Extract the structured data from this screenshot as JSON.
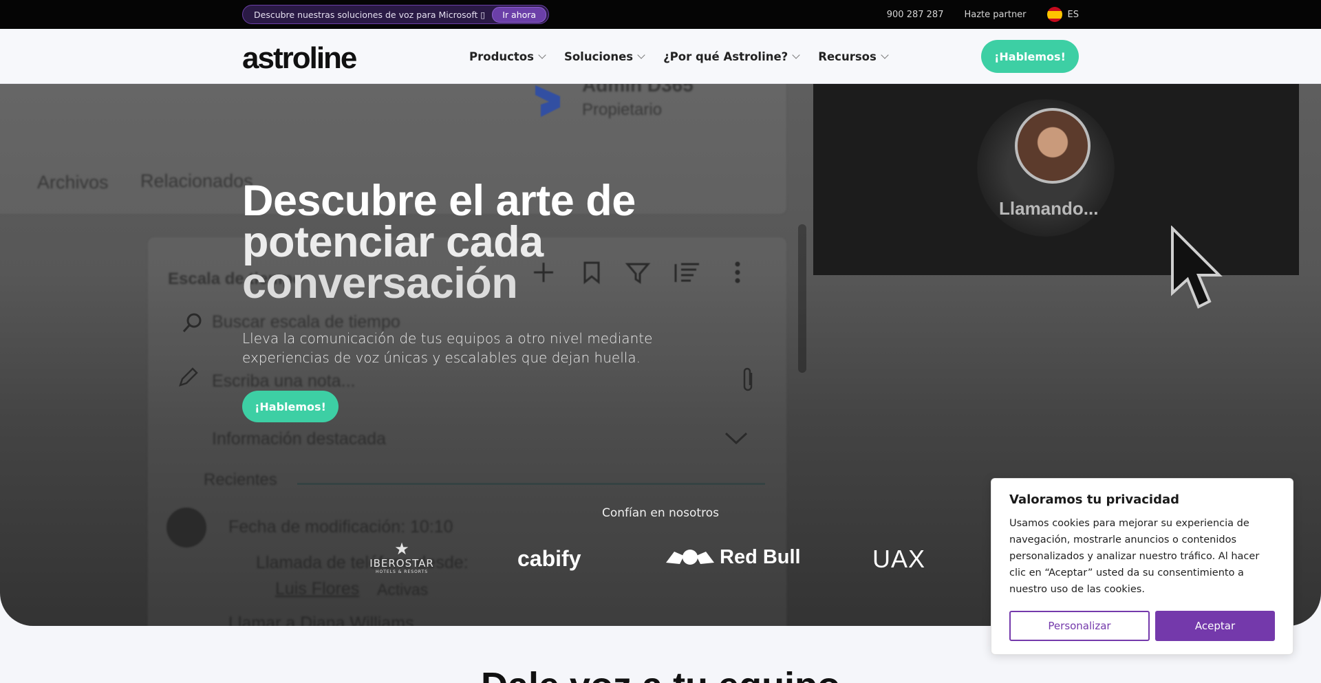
{
  "topbar": {
    "promo_text": "Descubre nuestras soluciones de voz para Microsoft ▯",
    "promo_cta": "Ir ahora",
    "phone": "900 287 287",
    "partner_link": "Hazte partner",
    "language": "ES"
  },
  "header": {
    "logo": "astroline",
    "nav": [
      {
        "label": "Productos"
      },
      {
        "label": "Soluciones"
      },
      {
        "label": "¿Por qué Astroline?"
      },
      {
        "label": "Recursos"
      }
    ],
    "cta": "¡Hablemos!"
  },
  "hero": {
    "title_line1": "Descubre el arte de",
    "title_line2": "potenciar cada",
    "title_line3": "conversación",
    "subtitle": "Lleva la comunicación de tus equipos a otro nivel mediante experiencias de voz únicas y escalables que dejan huella.",
    "cta": "¡Hablemos!",
    "background": {
      "admin": "Admin D365",
      "owner": "Propietario",
      "tab_files": "Archivos",
      "tab_related": "Relacionados",
      "timeline_title": "Escala de tiempo",
      "search_timeline": "Buscar escala de tiempo",
      "note_placeholder": "Escriba una nota...",
      "highlight": "Información destacada",
      "recent": "Recientes",
      "modified": "Fecha de modificación: 10:10",
      "call_from": "Llamada de teléfono desde:",
      "contact": "Luis Flores",
      "active": "Activas",
      "call_to": "Llamar a Diana Williams",
      "calling": "Llamando..."
    },
    "trust_label": "Confían en nosotros",
    "brands": [
      "IBEROSTAR",
      "cabify",
      "Red Bull",
      "UAX"
    ],
    "iberostar_sub": "HOTELS & RESORTS"
  },
  "next_section": {
    "title": "Dale voz a tu equipo"
  },
  "cookie": {
    "title": "Valoramos tu privacidad",
    "body": "Usamos cookies para mejorar su experiencia de navegación, mostrarle anuncios o contenidos personalizados y analizar nuestro tráfico. Al hacer clic en “Aceptar” usted da su consentimiento a nuestro uso de las cookies.",
    "customize": "Personalizar",
    "accept": "Aceptar"
  },
  "colors": {
    "accent_green": "#3dcfa4",
    "accent_purple": "#7439ab",
    "topbar_bg": "#050505"
  }
}
